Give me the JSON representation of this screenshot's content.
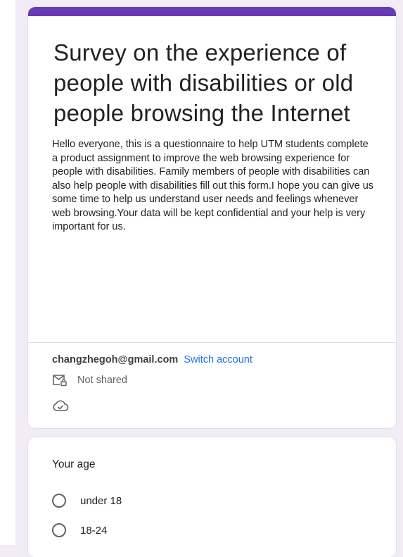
{
  "form": {
    "title": "Survey on the experience of people with disabilities or old people browsing the Internet",
    "description": "Hello everyone, this is a questionnaire to help UTM students complete a product assignment to improve the web browsing experience for people with disabilities. Family members of people with disabilities can also help people with disabilities fill out this form.I hope you can give us some time to help us understand user needs and feelings whenever web browsing.Your data will be kept confidential and your help is very important for us.",
    "accent_color": "#673ab7"
  },
  "account": {
    "email": "changzhegoh@gmail.com",
    "switch_label": "Switch account",
    "not_shared_label": "Not shared",
    "not_shared_icon": "mail-lock-icon",
    "save_status_icon": "cloud-check-icon"
  },
  "question": {
    "title": "Your age",
    "options": [
      {
        "label": "under 18"
      },
      {
        "label": "18-24"
      }
    ]
  }
}
